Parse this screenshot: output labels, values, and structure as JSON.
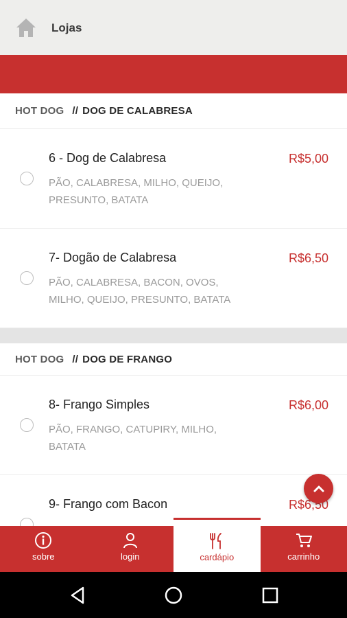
{
  "topbar": {
    "title": "Lojas",
    "icon": "home-icon"
  },
  "sections": [
    {
      "category": "HOT DOG",
      "separator": "//",
      "subcategory": "DOG DE CALABRESA",
      "items": [
        {
          "name": "6 - Dog de Calabresa",
          "price": "R$5,00",
          "desc": "Pão, calabresa, milho, queijo, presunto, batata"
        },
        {
          "name": "7- Dogão de Calabresa",
          "price": "R$6,50",
          "desc": "Pão, calabresa, bacon, ovos, milho, queijo, presunto, batata"
        }
      ]
    },
    {
      "category": "HOT DOG",
      "separator": "//",
      "subcategory": "DOG DE FRANGO",
      "items": [
        {
          "name": "8- Frango Simples",
          "price": "R$6,00",
          "desc": "Pão, frango, catupiry, milho, batata"
        },
        {
          "name": "9- Frango com Bacon",
          "price": "R$6,50",
          "desc": ""
        }
      ]
    }
  ],
  "nav": {
    "tabs": [
      {
        "label": "sobre",
        "icon": "info-icon"
      },
      {
        "label": "login",
        "icon": "user-icon"
      },
      {
        "label": "cardápio",
        "icon": "cutlery-icon",
        "active": true
      },
      {
        "label": "carrinho",
        "icon": "cart-icon"
      }
    ]
  },
  "colors": {
    "primary": "#c7302f",
    "topbar": "#eeeeec",
    "text": "#222222",
    "muted": "#9a9a9a"
  }
}
